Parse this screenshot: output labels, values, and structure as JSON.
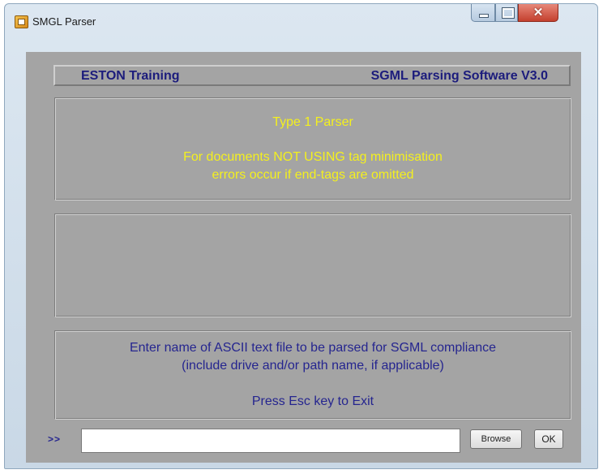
{
  "window": {
    "title": "SMGL Parser",
    "controls": {
      "minimize": "—",
      "maximize": "□",
      "close": "✕"
    }
  },
  "header": {
    "left": "ESTON Training",
    "right": "SGML Parsing Software V3.0"
  },
  "parser_info": {
    "title": "Type 1 Parser",
    "line1": "For documents NOT USING tag minimisation",
    "line2": "errors occur if end-tags are omitted"
  },
  "instructions": {
    "line1": "Enter name of ASCII text file to be parsed for SGML compliance",
    "line2": "(include drive and/or path name, if applicable)",
    "line3": "Press Esc key to Exit"
  },
  "input_row": {
    "prompt": ">>",
    "file_value": "",
    "browse_label": "Browse",
    "ok_label": "OK"
  },
  "colors": {
    "panel_bg": "#a4a4a4",
    "navy_text": "#25258f",
    "yellow_text": "#f4f01e"
  }
}
